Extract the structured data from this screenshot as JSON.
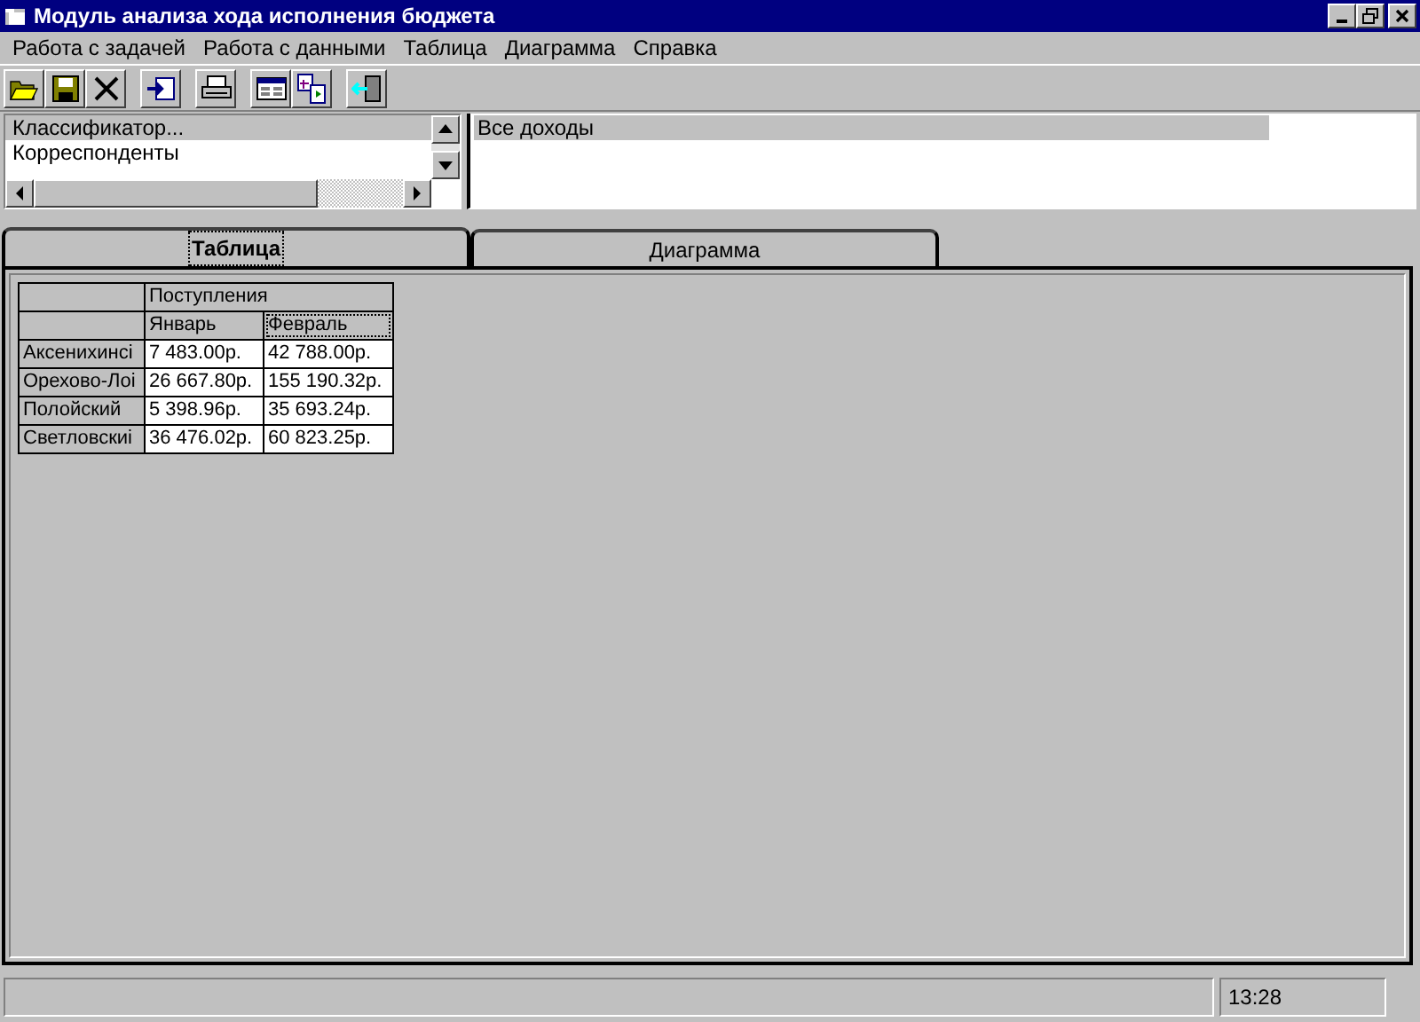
{
  "window": {
    "title": "Модуль анализа хода исполнения бюджета"
  },
  "menu": [
    "Работа с задачей",
    "Работа с данными",
    "Таблица",
    "Диаграмма",
    "Справка"
  ],
  "toolbar": [
    [
      {
        "kind": "open"
      },
      {
        "kind": "save"
      },
      {
        "kind": "delete"
      }
    ],
    [
      {
        "kind": "import"
      }
    ],
    [
      {
        "kind": "print"
      }
    ],
    [
      {
        "kind": "table"
      },
      {
        "kind": "transfer"
      }
    ],
    [
      {
        "kind": "exit"
      }
    ]
  ],
  "left_list": {
    "items": [
      {
        "label": "Классификатор...",
        "selected": true
      },
      {
        "label": "Корреспонденты",
        "selected": false
      }
    ]
  },
  "right_list": {
    "items": [
      {
        "label": "Все доходы",
        "selected": true
      }
    ]
  },
  "tabs": [
    {
      "label": "Таблица",
      "selected": true
    },
    {
      "label": "Диаграмма",
      "selected": false
    }
  ],
  "table": {
    "group_header": "Поступления",
    "columns": [
      {
        "label": "Январь",
        "selected": false
      },
      {
        "label": "Февраль",
        "selected": true
      }
    ],
    "rows": [
      {
        "name": "Аксенихинсі",
        "cells": [
          "7 483.00р.",
          "42 788.00р."
        ]
      },
      {
        "name": "Орехово-Лоі",
        "cells": [
          "26 667.80р.",
          "155 190.32р."
        ]
      },
      {
        "name": "Полойский",
        "cells": [
          "5 398.96р.",
          "35 693.24р."
        ]
      },
      {
        "name": "Светловскиі",
        "cells": [
          "36 476.02р.",
          "60 823.25р."
        ]
      }
    ]
  },
  "status_bar": {
    "time": "13:28"
  }
}
